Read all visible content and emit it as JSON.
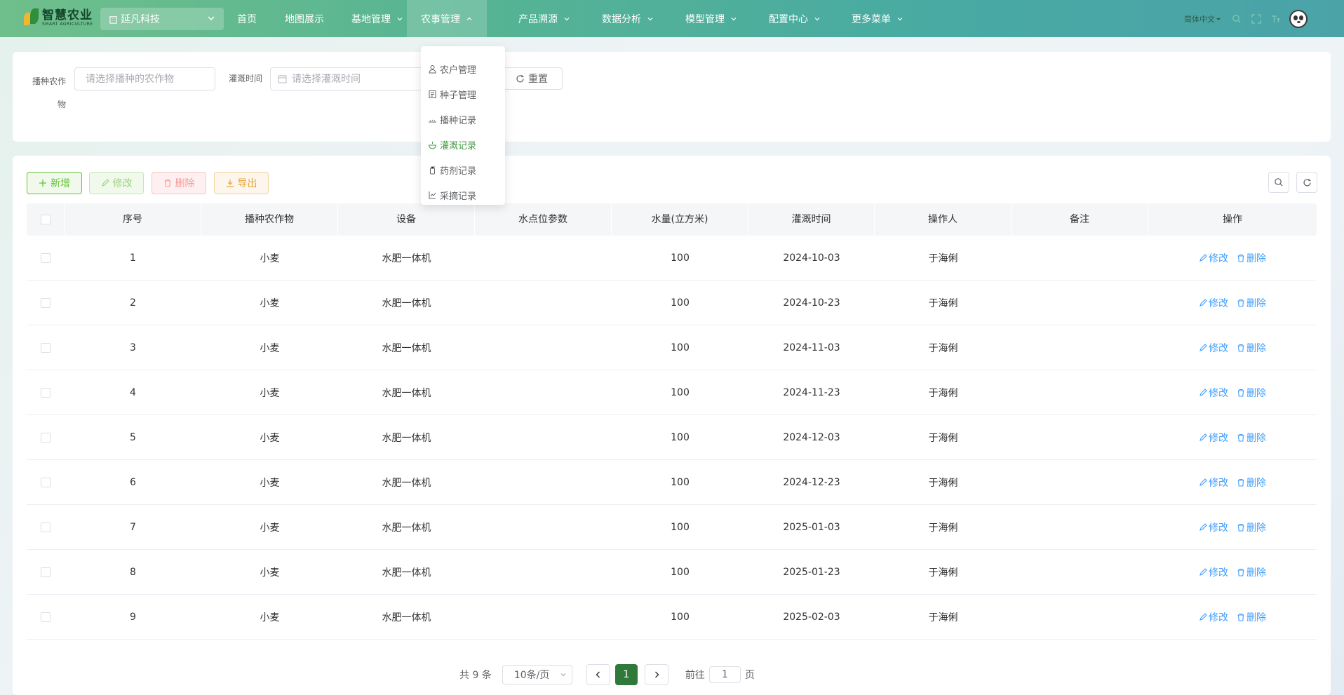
{
  "app": {
    "logo_title": "智慧农业",
    "logo_subtitle": "SMART AGRICULTURE",
    "company": "延凡科技"
  },
  "nav": [
    {
      "label": "首页",
      "has_arrow": false,
      "active": false
    },
    {
      "label": "地图展示",
      "has_arrow": false,
      "active": false
    },
    {
      "label": "基地管理",
      "has_arrow": true,
      "active": false
    },
    {
      "label": "农事管理",
      "has_arrow": true,
      "active": true
    },
    {
      "label": "产品溯源",
      "has_arrow": true,
      "active": false
    },
    {
      "label": "数据分析",
      "has_arrow": true,
      "active": false
    },
    {
      "label": "模型管理",
      "has_arrow": true,
      "active": false
    },
    {
      "label": "配置中心",
      "has_arrow": true,
      "active": false
    },
    {
      "label": "更多菜单",
      "has_arrow": true,
      "active": false
    }
  ],
  "toolbar_right": {
    "language": "简体中文"
  },
  "dropdown": [
    {
      "label": "农户管理",
      "icon": "user-icon",
      "selected": false
    },
    {
      "label": "种子管理",
      "icon": "seed-icon",
      "selected": false
    },
    {
      "label": "播种记录",
      "icon": "sowing-icon",
      "selected": false
    },
    {
      "label": "灌溉记录",
      "icon": "irrigation-icon",
      "selected": true
    },
    {
      "label": "药剂记录",
      "icon": "pesticide-icon",
      "selected": false
    },
    {
      "label": "采摘记录",
      "icon": "harvest-icon",
      "selected": false
    }
  ],
  "search": {
    "crop_label": "播种农作物",
    "crop_placeholder": "请选择播种的农作物",
    "time_label": "灌溉时间",
    "time_placeholder": "请选择灌溉时间",
    "reset_label": "重置"
  },
  "actions": {
    "add": "新增",
    "edit": "修改",
    "delete": "删除",
    "export": "导出"
  },
  "table": {
    "headers": [
      "序号",
      "播种农作物",
      "设备",
      "水点位参数",
      "水量(立方米)",
      "灌溉时间",
      "操作人",
      "备注",
      "操作"
    ],
    "rows": [
      {
        "no": "1",
        "crop": "小麦",
        "device": "水肥一体机",
        "param": "",
        "water": "100",
        "time": "2024-10-03",
        "operator": "于海俐",
        "note": ""
      },
      {
        "no": "2",
        "crop": "小麦",
        "device": "水肥一体机",
        "param": "",
        "water": "100",
        "time": "2024-10-23",
        "operator": "于海俐",
        "note": ""
      },
      {
        "no": "3",
        "crop": "小麦",
        "device": "水肥一体机",
        "param": "",
        "water": "100",
        "time": "2024-11-03",
        "operator": "于海俐",
        "note": ""
      },
      {
        "no": "4",
        "crop": "小麦",
        "device": "水肥一体机",
        "param": "",
        "water": "100",
        "time": "2024-11-23",
        "operator": "于海俐",
        "note": ""
      },
      {
        "no": "5",
        "crop": "小麦",
        "device": "水肥一体机",
        "param": "",
        "water": "100",
        "time": "2024-12-03",
        "operator": "于海俐",
        "note": ""
      },
      {
        "no": "6",
        "crop": "小麦",
        "device": "水肥一体机",
        "param": "",
        "water": "100",
        "time": "2024-12-23",
        "operator": "于海俐",
        "note": ""
      },
      {
        "no": "7",
        "crop": "小麦",
        "device": "水肥一体机",
        "param": "",
        "water": "100",
        "time": "2025-01-03",
        "operator": "于海俐",
        "note": ""
      },
      {
        "no": "8",
        "crop": "小麦",
        "device": "水肥一体机",
        "param": "",
        "water": "100",
        "time": "2025-01-23",
        "operator": "于海俐",
        "note": ""
      },
      {
        "no": "9",
        "crop": "小麦",
        "device": "水肥一体机",
        "param": "",
        "water": "100",
        "time": "2025-02-03",
        "operator": "于海俐",
        "note": ""
      }
    ],
    "row_edit": "修改",
    "row_delete": "删除"
  },
  "pagination": {
    "total": "共 9 条",
    "page_size": "10条/页",
    "current_page": "1",
    "goto_prefix": "前往",
    "goto_value": "1",
    "goto_suffix": "页"
  },
  "colors": {
    "primary": "#409eff",
    "brand_green": "#3f9b3f",
    "add_green": "#67c23a",
    "danger": "#f56c6c",
    "warning": "#e6a23c"
  }
}
